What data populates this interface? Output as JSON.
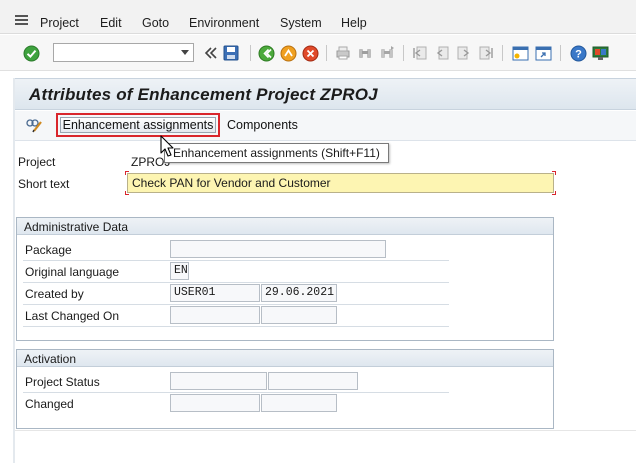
{
  "menu": {
    "items": [
      "Project",
      "Edit",
      "Goto",
      "Environment",
      "System",
      "Help"
    ]
  },
  "toolbar": {
    "command_value": "",
    "icons": [
      "enter-check-icon",
      "double-chevron-left-icon",
      "save-icon",
      "back-icon",
      "exit-icon",
      "cancel-icon",
      "print-icon",
      "find-icon",
      "find-next-icon",
      "first-page-icon",
      "previous-page-icon",
      "next-page-icon",
      "last-page-icon",
      "new-session-icon",
      "shortcut-icon",
      "help-icon",
      "customize-layout-icon"
    ]
  },
  "page": {
    "title": "Attributes of Enhancement Project ZPROJ"
  },
  "app_toolbar": {
    "enhancement_label": "Enhancement assignments",
    "components_label": "Components"
  },
  "tooltip": {
    "text": "Enhancement assignments   (Shift+F11)"
  },
  "header": {
    "project_label": "Project",
    "project_value": "ZPROJ",
    "short_text_label": "Short text",
    "short_text_value": "Check PAN for Vendor and Customer"
  },
  "admin": {
    "title": "Administrative Data",
    "package_label": "Package",
    "package_value": "",
    "language_label": "Original language",
    "language_value": "EN",
    "created_label": "Created by",
    "created_user": "USER01",
    "created_date": "29.06.2021",
    "changed_label": "Last Changed On",
    "changed_user": "",
    "changed_date": ""
  },
  "activation": {
    "title": "Activation",
    "status_label": "Project Status",
    "status_value_1": "",
    "status_value_2": "",
    "changed_label": "Changed",
    "changed_value_1": "",
    "changed_value_2": ""
  },
  "colors": {
    "required_field_bg": "#fdf5b2",
    "highlight_border": "#d9262c",
    "group_border": "#aab7c4"
  }
}
